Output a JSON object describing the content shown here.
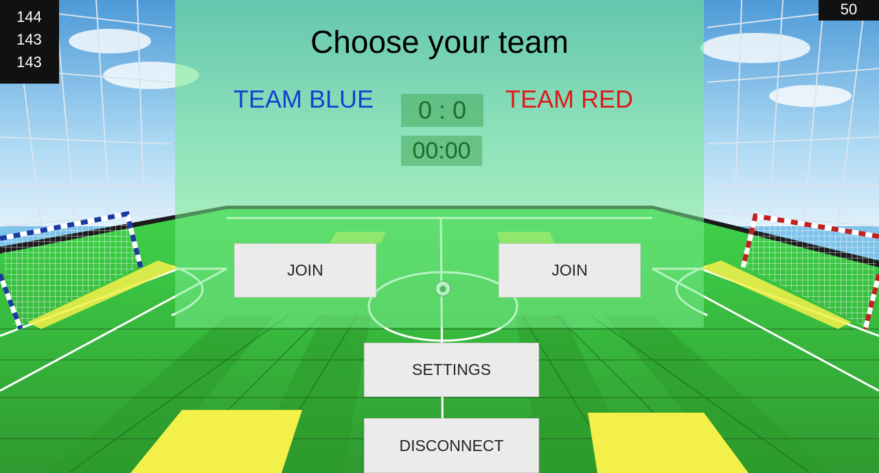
{
  "stats": [
    "144",
    "143",
    "143"
  ],
  "fps": "50",
  "title": "Choose your team",
  "teams": {
    "blue": {
      "name": "TEAM BLUE",
      "join_label": "JOIN",
      "color": "#1440d0"
    },
    "red": {
      "name": "TEAM RED",
      "join_label": "JOIN",
      "color": "#e01818"
    }
  },
  "score": "0 : 0",
  "timer": "00:00",
  "buttons": {
    "settings": "SETTINGS",
    "disconnect": "DISCONNECT"
  },
  "colors": {
    "panel": "#78eb8c",
    "pitch": "#3fbf3f",
    "lines": "#ffffff",
    "yellow": "#f4f04a"
  },
  "icons": {
    "ball": "soccer-ball-icon"
  }
}
